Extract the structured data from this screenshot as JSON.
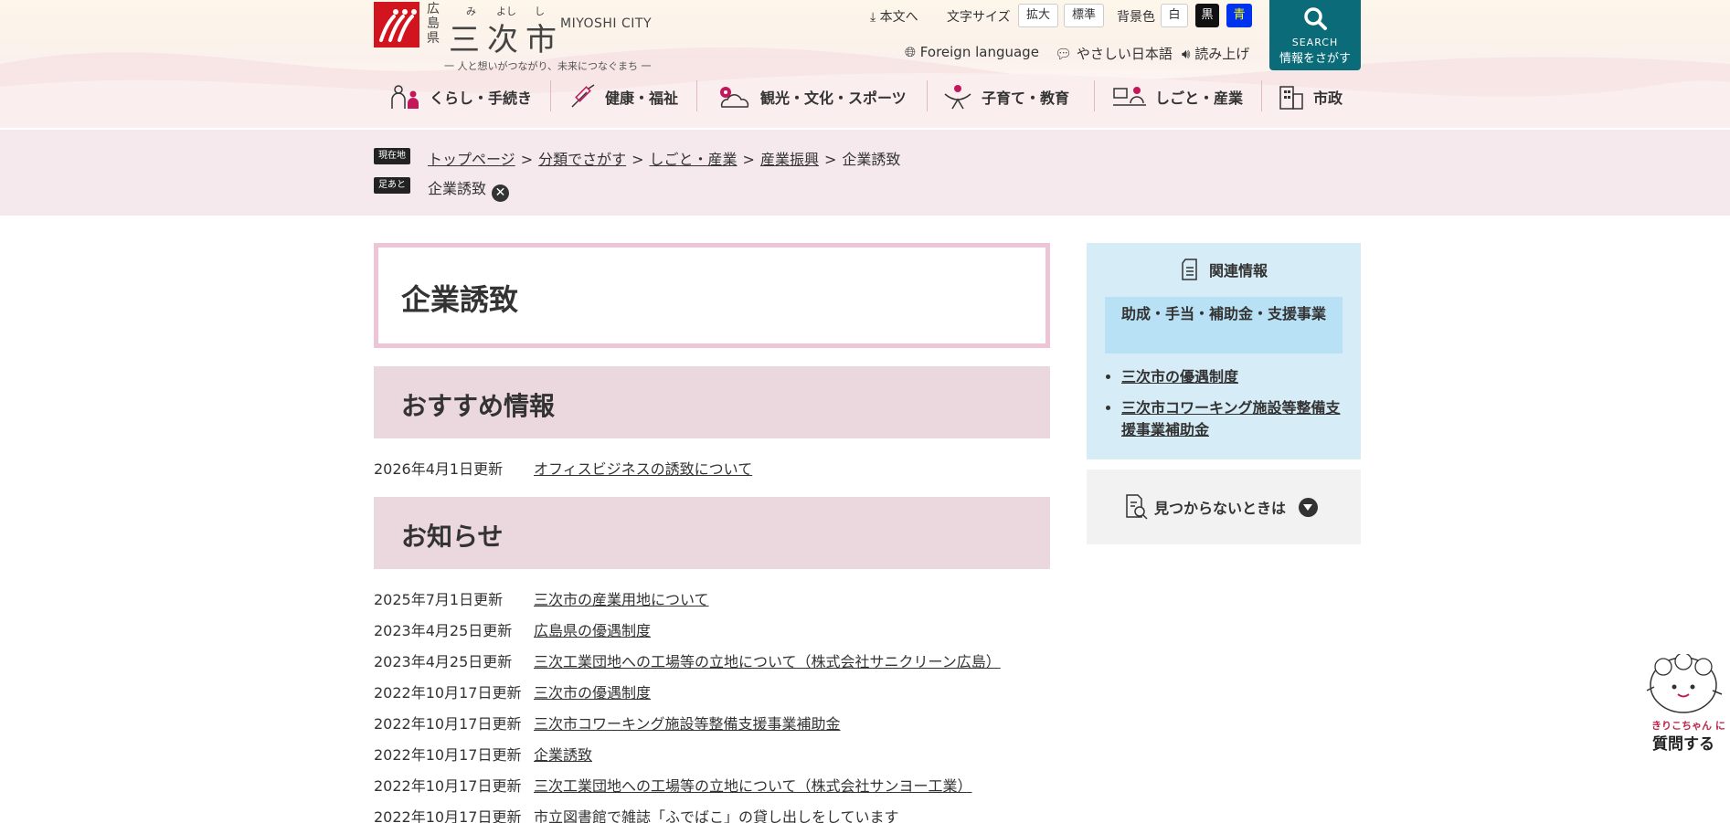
{
  "header": {
    "pref": "広島県",
    "city_name": "三次市",
    "ruby": [
      "み",
      "よし",
      "し"
    ],
    "city_en": "MIYOSHI CITY",
    "tagline": "一 人と想いがつながり、未来につなぐまち 一",
    "skip_label": "本文へ",
    "font_size_label": "文字サイズ",
    "font_large": "拡大",
    "font_normal": "標準",
    "bg_label": "背景色",
    "bg_white": "白",
    "bg_black": "黒",
    "bg_blue": "青",
    "foreign_language": "Foreign language",
    "easy_japanese": "やさしい日本語",
    "read_aloud": "読み上げ",
    "search_en": "SEARCH",
    "search_ja": "情報をさがす"
  },
  "nav": [
    {
      "label": "くらし・手続き",
      "icon": "people-icon"
    },
    {
      "label": "健康・福祉",
      "icon": "syringe-icon"
    },
    {
      "label": "観光・文化・スポーツ",
      "icon": "flower-cloud-icon"
    },
    {
      "label": "子育て・教育",
      "icon": "parent-child-icon"
    },
    {
      "label": "しごと・産業",
      "icon": "office-worker-icon"
    },
    {
      "label": "市政",
      "icon": "building-icon"
    }
  ],
  "breadcrumb": {
    "current_tag": "現在地",
    "footprint_tag": "足あと",
    "items": [
      "トップページ",
      "分類でさがす",
      "しごと・産業",
      "産業振興"
    ],
    "current": "企業誘致",
    "footprint_item": "企業誘致"
  },
  "main": {
    "page_title": "企業誘致",
    "recommended_heading": "おすすめ情報",
    "recommended": [
      {
        "date": "2026年4月1日更新",
        "title": "オフィスビジネスの誘致について"
      }
    ],
    "news_heading": "お知らせ",
    "news": [
      {
        "date": "2025年7月1日更新",
        "title": "三次市の産業用地について"
      },
      {
        "date": "2023年4月25日更新",
        "title": "広島県の優遇制度"
      },
      {
        "date": "2023年4月25日更新",
        "title": "三次工業団地への工場等の立地について（株式会社サニクリーン広島）"
      },
      {
        "date": "2022年10月17日更新",
        "title": "三次市の優遇制度"
      },
      {
        "date": "2022年10月17日更新",
        "title": "三次市コワーキング施設等整備支援事業補助金"
      },
      {
        "date": "2022年10月17日更新",
        "title": "企業誘致"
      },
      {
        "date": "2022年10月17日更新",
        "title": "三次工業団地への工場等の立地について（株式会社サンヨー工業）"
      },
      {
        "date": "2022年10月17日更新",
        "title": "市立図書館で雑誌「ふでばこ」の貸し出しをしています"
      }
    ]
  },
  "sidebar": {
    "related_heading": "関連情報",
    "category": "助成・手当・補助金・支援事業",
    "links": [
      "三次市の優遇制度",
      "三次市コワーキング施設等整備支援事業補助金"
    ],
    "not_found": "見つからないときは"
  },
  "chatbot": {
    "name": "きりこちゃん",
    "particle": "に",
    "action": "質問する"
  },
  "colors": {
    "brand_red": "#d2141e",
    "search_teal": "#0b6b78",
    "breadcrumb_bg": "#f5e9ed",
    "section_bg": "#ebd8df",
    "related_bg": "#d6edf8"
  }
}
